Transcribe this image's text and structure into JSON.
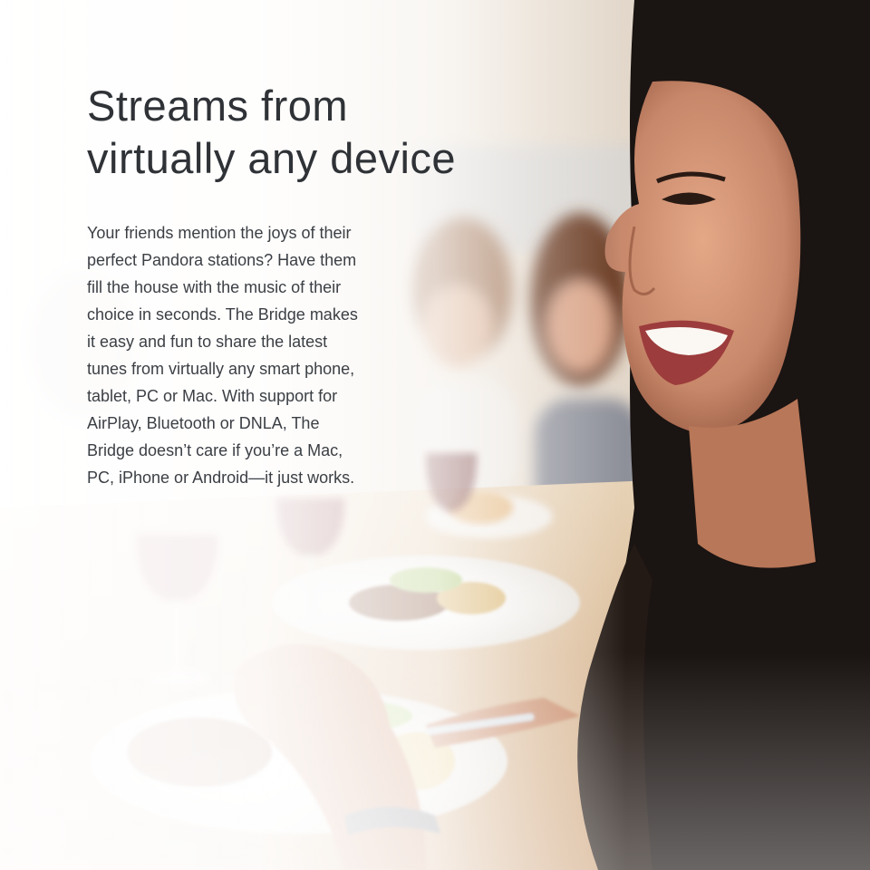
{
  "headline": {
    "line1": "Streams from",
    "line2": "virtually any device"
  },
  "body": {
    "lines": [
      "Your friends mention the joys of their",
      "perfect Pandora stations? Have them",
      "fill the house with the music of their",
      "choice in seconds. The Bridge makes",
      "it easy and fun to share the latest",
      "tunes from virtually any smart phone,",
      "tablet, PC or Mac. With support for",
      "AirPlay, Bluetooth or DNLA, The",
      "Bridge doesn’t care if you’re a Mac,",
      "PC, iPhone or Android—it just works."
    ]
  },
  "colors": {
    "headline": "#2f3236",
    "body_text": "#3b3f44",
    "hair": "#1a1412",
    "skin": "#c98a6a",
    "wine": "#6a1018"
  }
}
